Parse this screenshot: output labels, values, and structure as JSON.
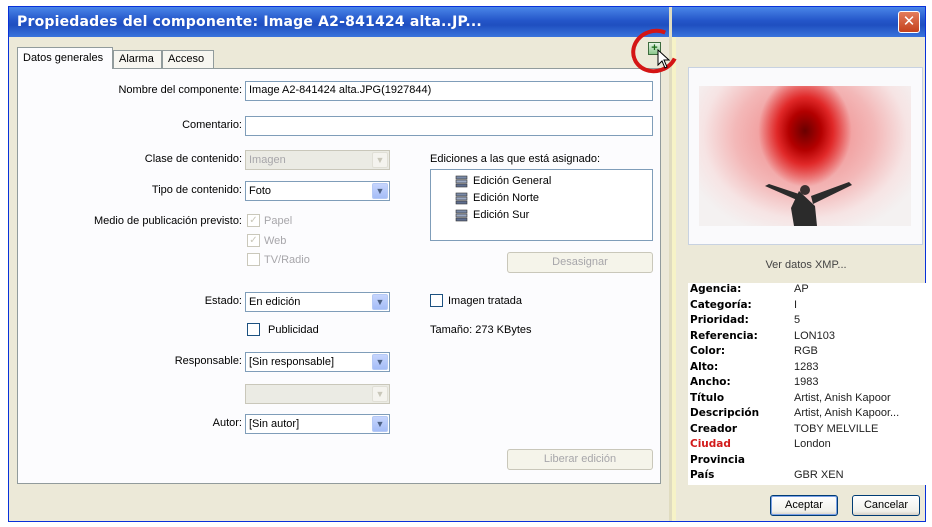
{
  "window": {
    "title": "Propiedades del componente:  Image A2-841424 alta..JP...",
    "close_glyph": "✕"
  },
  "tabs": [
    {
      "label": "Datos generales",
      "active": true
    },
    {
      "label": "Alarma",
      "active": false
    },
    {
      "label": "Acceso",
      "active": false
    }
  ],
  "form": {
    "nombre_label": "Nombre del componente:",
    "nombre_value": "Image A2-841424 alta.JPG(1927844)",
    "comentario_label": "Comentario:",
    "comentario_value": "",
    "clase_label": "Clase de contenido:",
    "clase_value": "Imagen",
    "tipo_label": "Tipo de contenido:",
    "tipo_value": "Foto",
    "medio_label": "Medio de publicación previsto:",
    "medio_options": [
      {
        "label": "Papel",
        "checked": true
      },
      {
        "label": "Web",
        "checked": true
      },
      {
        "label": "TV/Radio",
        "checked": false
      }
    ],
    "estado_label": "Estado:",
    "estado_value": "En edición",
    "publicidad_label": "Publicidad",
    "responsable_label": "Responsable:",
    "responsable_value": "[Sin responsable]",
    "responsable_sub_value": "",
    "autor_label": "Autor:",
    "autor_value": "[Sin autor]",
    "ediciones_label": "Ediciones a las que está asignado:",
    "ediciones": [
      "Edición General",
      "Edición Norte",
      "Edición Sur"
    ],
    "desasignar_label": "Desasignar",
    "imagen_tratada_label": "Imagen tratada",
    "tamano_label": "Tamaño:  273 KBytes",
    "liberar_label": "Liberar edición"
  },
  "sidebar": {
    "xmp_link": "Ver datos XMP...",
    "xmp": [
      {
        "key": "Agencia:",
        "value": "AP",
        "highlight": false
      },
      {
        "key": "Categoría:",
        "value": "I",
        "highlight": false
      },
      {
        "key": "Prioridad:",
        "value": "5",
        "highlight": false
      },
      {
        "key": "Referencia:",
        "value": "LON103",
        "highlight": false
      },
      {
        "key": "Color:",
        "value": "RGB",
        "highlight": false
      },
      {
        "key": "Alto:",
        "value": "1283",
        "highlight": false
      },
      {
        "key": "Ancho:",
        "value": "1983",
        "highlight": false
      },
      {
        "key": "Título",
        "value": "Artist, Anish Kapoor",
        "highlight": false
      },
      {
        "key": "Descripción",
        "value": "Artist, Anish Kapoor...",
        "highlight": false
      },
      {
        "key": "Creador",
        "value": "TOBY MELVILLE",
        "highlight": false
      },
      {
        "key": "Ciudad",
        "value": "London",
        "highlight": true
      },
      {
        "key": "Provincia",
        "value": "",
        "highlight": false
      },
      {
        "key": "País",
        "value": "GBR XEN",
        "highlight": false
      }
    ],
    "accept_label": "Aceptar",
    "cancel_label": "Cancelar"
  },
  "colors": {
    "titlebar": "#2456c9",
    "highlight": "#d21a1a",
    "annotation_circle": "#d41515"
  }
}
